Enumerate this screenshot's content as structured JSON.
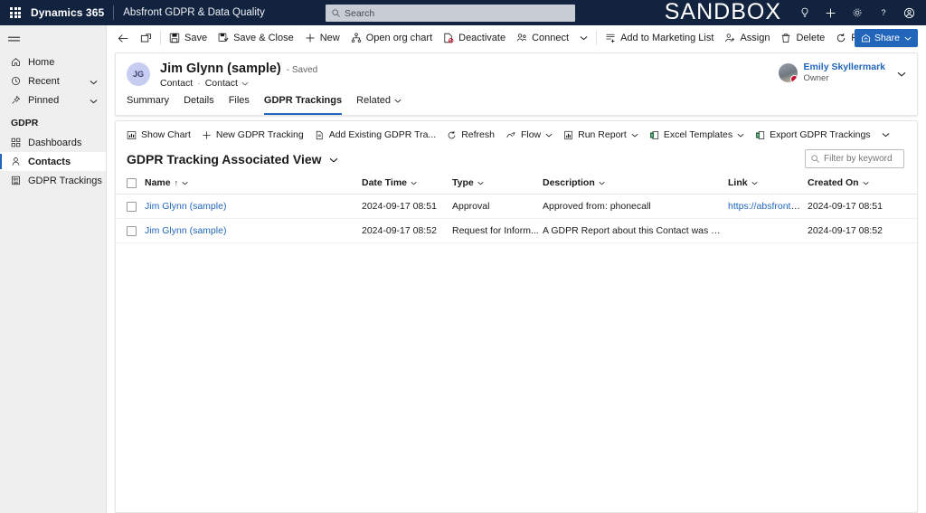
{
  "topnav": {
    "waffle": "app-launcher",
    "brand": "Dynamics 365",
    "app_name": "Absfront GDPR & Data Quality",
    "search_placeholder": "Search",
    "environment_label": "SANDBOX",
    "icons": [
      "lightbulb-icon",
      "plus-icon",
      "gear-icon",
      "help-icon",
      "account-icon"
    ]
  },
  "sidebar": {
    "hamburger": "menu-icon",
    "items": [
      {
        "label": "Home",
        "icon": "home-icon",
        "chevron": false,
        "selected": false
      },
      {
        "label": "Recent",
        "icon": "clock-icon",
        "chevron": true,
        "selected": false
      },
      {
        "label": "Pinned",
        "icon": "pin-icon",
        "chevron": true,
        "selected": false
      }
    ],
    "group_title": "GDPR",
    "group_items": [
      {
        "label": "Dashboards",
        "icon": "dashboard-icon",
        "selected": false
      },
      {
        "label": "Contacts",
        "icon": "contact-icon",
        "selected": true
      },
      {
        "label": "GDPR Trackings",
        "icon": "gdpr-icon",
        "selected": false
      }
    ]
  },
  "commandbar": {
    "back": "back-arrow-icon",
    "popout": "popout-icon",
    "items": [
      {
        "label": "Save",
        "icon": "save-icon"
      },
      {
        "label": "Save & Close",
        "icon": "save-close-icon"
      },
      {
        "label": "New",
        "icon": "plus-icon"
      },
      {
        "label": "Open org chart",
        "icon": "org-chart-icon"
      },
      {
        "label": "Deactivate",
        "icon": "deactivate-icon"
      },
      {
        "label": "Connect",
        "icon": "connect-icon"
      }
    ],
    "overflow_chevron": "chevron-down-icon",
    "items2": [
      {
        "label": "Add to Marketing List",
        "icon": "marketing-list-icon"
      },
      {
        "label": "Assign",
        "icon": "assign-icon"
      },
      {
        "label": "Delete",
        "icon": "delete-icon"
      },
      {
        "label": "Refresh",
        "icon": "refresh-icon"
      }
    ],
    "more": "more-vertical-icon",
    "share_label": "Share"
  },
  "record": {
    "avatar_initials": "JG",
    "name": "Jim Glynn (sample)",
    "saved_state": "- Saved",
    "entity_type": "Contact",
    "form_name": "Contact",
    "owner_name": "Emily Skyllermark",
    "owner_role": "Owner"
  },
  "tabs": [
    {
      "label": "Summary",
      "active": false,
      "chevron": false
    },
    {
      "label": "Details",
      "active": false,
      "chevron": false
    },
    {
      "label": "Files",
      "active": false,
      "chevron": false
    },
    {
      "label": "GDPR Trackings",
      "active": true,
      "chevron": false
    },
    {
      "label": "Related",
      "active": false,
      "chevron": true
    }
  ],
  "subgrid": {
    "commands": [
      {
        "label": "Show Chart",
        "icon": "chart-icon",
        "chevron": false
      },
      {
        "label": "New GDPR Tracking",
        "icon": "plus-icon",
        "chevron": false
      },
      {
        "label": "Add Existing GDPR Tra...",
        "icon": "add-existing-icon",
        "chevron": false
      },
      {
        "label": "Refresh",
        "icon": "refresh-icon",
        "chevron": false
      },
      {
        "label": "Flow",
        "icon": "flow-icon",
        "chevron": true
      },
      {
        "label": "Run Report",
        "icon": "report-icon",
        "chevron": true
      },
      {
        "label": "Excel Templates",
        "icon": "excel-icon",
        "chevron": true
      },
      {
        "label": "Export GDPR Trackings",
        "icon": "export-excel-icon",
        "chevron": false
      }
    ],
    "overflow_chevron": "chevron-down-icon",
    "view_title": "GDPR Tracking Associated View",
    "view_chevron": "chevron-down-icon",
    "filter_placeholder": "Filter by keyword",
    "columns": [
      {
        "label": "Name",
        "sorted": true,
        "sort_dir": "↑"
      },
      {
        "label": "Date Time",
        "sorted": false
      },
      {
        "label": "Type",
        "sorted": false
      },
      {
        "label": "Description",
        "sorted": false
      },
      {
        "label": "Link",
        "sorted": false
      },
      {
        "label": "Created On",
        "sorted": false
      }
    ],
    "rows": [
      {
        "name": "Jim Glynn (sample)",
        "date_time": "2024-09-17 08:51",
        "type": "Approval",
        "description": "Approved from: phonecall",
        "link": "https://absfrontgdpr-...",
        "created_on": "2024-09-17 08:51"
      },
      {
        "name": "Jim Glynn (sample)",
        "date_time": "2024-09-17 08:52",
        "type": "Request for Inform...",
        "description": "A GDPR Report about this Contact was Exported t...",
        "link": "",
        "created_on": "2024-09-17 08:52"
      }
    ]
  },
  "colors": {
    "nav_bg": "#12233f",
    "accent": "#2266bb",
    "sidebar_bg": "#efefef",
    "link": "#2266bb"
  }
}
